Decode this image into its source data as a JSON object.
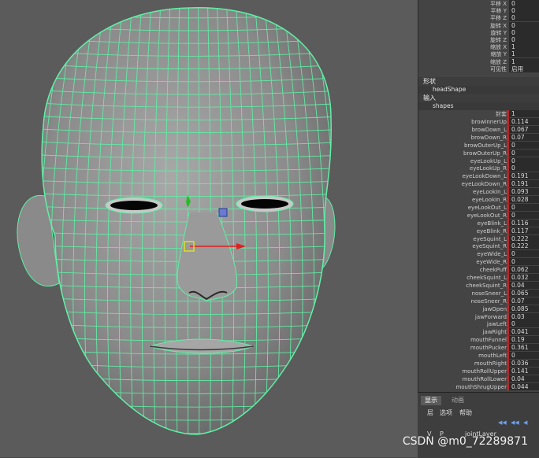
{
  "transform": [
    {
      "label": "平移 X",
      "value": "0"
    },
    {
      "label": "平移 Y",
      "value": "0"
    },
    {
      "label": "平移 Z",
      "value": "0"
    },
    {
      "label": "旋转 X",
      "value": "0"
    },
    {
      "label": "旋转 Y",
      "value": "0"
    },
    {
      "label": "旋转 Z",
      "value": "0"
    },
    {
      "label": "缩放 X",
      "value": "1"
    },
    {
      "label": "缩放 Y",
      "value": "1"
    },
    {
      "label": "缩放 Z",
      "value": "1"
    },
    {
      "label": "可见性",
      "value": "启用"
    }
  ],
  "shape_section": "形状",
  "shape_name": "headShape",
  "input_section": "输入",
  "input_name": "shapes",
  "envelope": {
    "label": "封套",
    "value": "1"
  },
  "blendshapes": [
    {
      "label": "browInnerUp",
      "value": "0.114"
    },
    {
      "label": "browDown_L",
      "value": "0.067"
    },
    {
      "label": "browDown_R",
      "value": "0.07"
    },
    {
      "label": "browOuterUp_L",
      "value": "0"
    },
    {
      "label": "browOuterUp_R",
      "value": "0"
    },
    {
      "label": "eyeLookUp_L",
      "value": "0"
    },
    {
      "label": "eyeLookUp_R",
      "value": "0"
    },
    {
      "label": "eyeLookDown_L",
      "value": "0.191"
    },
    {
      "label": "eyeLookDown_R",
      "value": "0.191"
    },
    {
      "label": "eyeLookIn_L",
      "value": "0.093"
    },
    {
      "label": "eyeLookIn_R",
      "value": "0.028"
    },
    {
      "label": "eyeLookOut_L",
      "value": "0"
    },
    {
      "label": "eyeLookOut_R",
      "value": "0"
    },
    {
      "label": "eyeBlink_L",
      "value": "0.116"
    },
    {
      "label": "eyeBlink_R",
      "value": "0.117"
    },
    {
      "label": "eyeSquint_L",
      "value": "0.222"
    },
    {
      "label": "eyeSquint_R",
      "value": "0.222"
    },
    {
      "label": "eyeWide_L",
      "value": "0"
    },
    {
      "label": "eyeWide_R",
      "value": "0"
    },
    {
      "label": "cheekPuff",
      "value": "0.062"
    },
    {
      "label": "cheekSquint_L",
      "value": "0.032"
    },
    {
      "label": "cheekSquint_R",
      "value": "0.04"
    },
    {
      "label": "noseSneer_L",
      "value": "0.065"
    },
    {
      "label": "noseSneer_R",
      "value": "0.07"
    },
    {
      "label": "jawOpen",
      "value": "0.085"
    },
    {
      "label": "jawForward",
      "value": "0.03"
    },
    {
      "label": "jawLeft",
      "value": "0"
    },
    {
      "label": "jawRight",
      "value": "0.041"
    },
    {
      "label": "mouthFunnel",
      "value": "0.19"
    },
    {
      "label": "mouthPucker",
      "value": "0.361"
    },
    {
      "label": "mouthLeft",
      "value": "0"
    },
    {
      "label": "mouthRight",
      "value": "0.036"
    },
    {
      "label": "mouthRollUpper",
      "value": "0.141"
    },
    {
      "label": "mouthRollLower",
      "value": "0.04"
    },
    {
      "label": "mouthShrugUpper",
      "value": "0.044"
    }
  ],
  "bottom": {
    "tab_display": "显示",
    "tab_anim": "动画",
    "menu_layer": "层",
    "menu_options": "选项",
    "menu_help": "帮助",
    "col_v": "V",
    "col_p": "P",
    "layer_name": "jointLayer"
  },
  "watermark": "CSDN @m0_72289871",
  "colors": {
    "wire": "#5ff0a6",
    "mesh": "#8f8f8f",
    "mark": "#b22a2a"
  }
}
